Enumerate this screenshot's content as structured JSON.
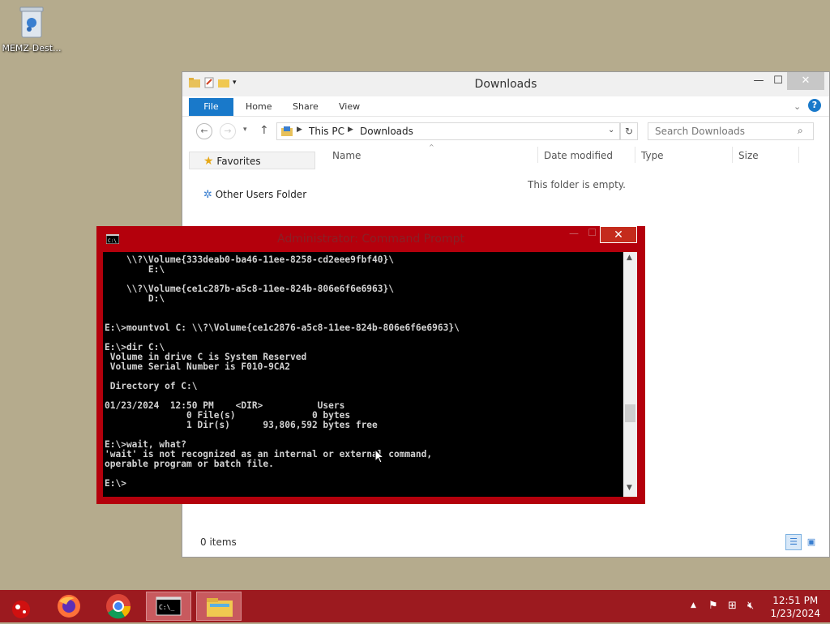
{
  "desktop": {
    "recycle_bin_label": "MEMZ-Dest..."
  },
  "explorer": {
    "title": "Downloads",
    "ribbon_tabs": [
      "File",
      "Home",
      "Share",
      "View"
    ],
    "address": {
      "root": "This PC",
      "current": "Downloads"
    },
    "search_placeholder": "Search Downloads",
    "sidebar": [
      "Favorites",
      "Other Users Folder"
    ],
    "columns": [
      "Name",
      "Date modified",
      "Type",
      "Size"
    ],
    "empty_message": "This folder is empty.",
    "status": "0 items",
    "help_glyph": "?"
  },
  "cmd": {
    "title": "Administrator: Command Prompt",
    "console_text": "    \\\\?\\Volume{333deab0-ba46-11ee-8258-cd2eee9fbf40}\\\n        E:\\\n\n    \\\\?\\Volume{ce1c287b-a5c8-11ee-824b-806e6f6e6963}\\\n        D:\\\n\n\nE:\\>mountvol C: \\\\?\\Volume{ce1c2876-a5c8-11ee-824b-806e6f6e6963}\\\n\nE:\\>dir C:\\\n Volume in drive C is System Reserved\n Volume Serial Number is F010-9CA2\n\n Directory of C:\\\n\n01/23/2024  12:50 PM    <DIR>          Users\n               0 File(s)              0 bytes\n               1 Dir(s)      93,806,592 bytes free\n\nE:\\>wait, what?\n'wait' is not recognized as an internal or external command,\noperable program or batch file.\n\nE:\\>"
  },
  "taskbar": {
    "time": "12:51 PM",
    "date": "1/23/2024"
  },
  "icons": {
    "recycle_bin": "recycle-bin-icon",
    "cmd": "cmd-icon",
    "firefox": "firefox-icon",
    "chrome": "chrome-icon",
    "explorer": "file-explorer-icon"
  },
  "colors": {
    "taskbar": "#9c1a1f",
    "cmd_border": "#b4000c",
    "ribbon_file": "#1979ca",
    "desktop": "#b5ab8d"
  }
}
